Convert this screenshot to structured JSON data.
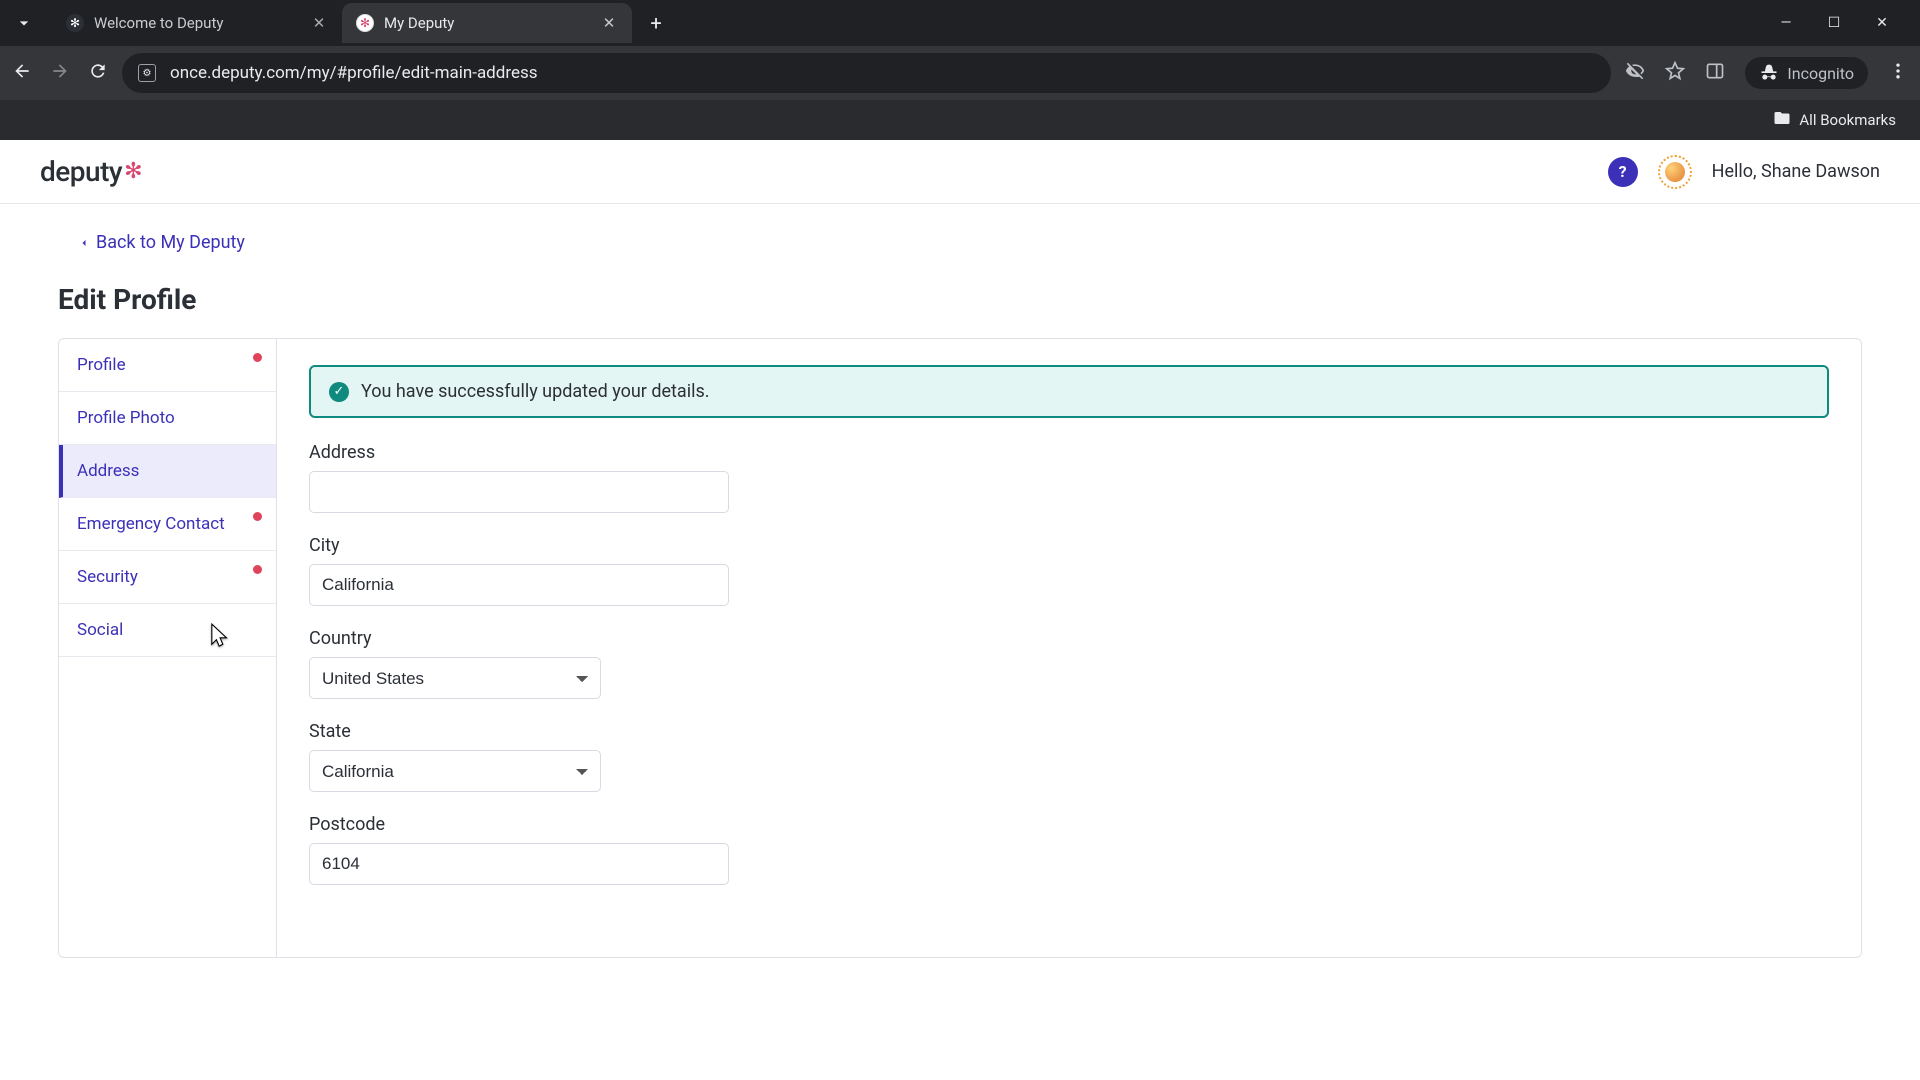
{
  "browser": {
    "tabs": [
      {
        "title": "Welcome to Deputy",
        "active": false
      },
      {
        "title": "My Deputy",
        "active": true
      }
    ],
    "url": "once.deputy.com/my/#profile/edit-main-address",
    "incognito_label": "Incognito",
    "all_bookmarks": "All Bookmarks"
  },
  "header": {
    "logo_text": "deputy",
    "greeting": "Hello, Shane Dawson"
  },
  "nav": {
    "back_link": "Back to My Deputy",
    "page_title": "Edit Profile",
    "tabs": [
      {
        "label": "Profile",
        "active": false,
        "dot": true
      },
      {
        "label": "Profile Photo",
        "active": false,
        "dot": false
      },
      {
        "label": "Address",
        "active": true,
        "dot": false
      },
      {
        "label": "Emergency Contact",
        "active": false,
        "dot": true
      },
      {
        "label": "Security",
        "active": false,
        "dot": true
      },
      {
        "label": "Social",
        "active": false,
        "dot": false
      }
    ]
  },
  "banner": {
    "message": "You have successfully updated your details."
  },
  "form": {
    "address_label": "Address",
    "address_value": "",
    "city_label": "City",
    "city_value": "California",
    "country_label": "Country",
    "country_value": "United States",
    "state_label": "State",
    "state_value": "California",
    "postcode_label": "Postcode",
    "postcode_value": "6104"
  }
}
